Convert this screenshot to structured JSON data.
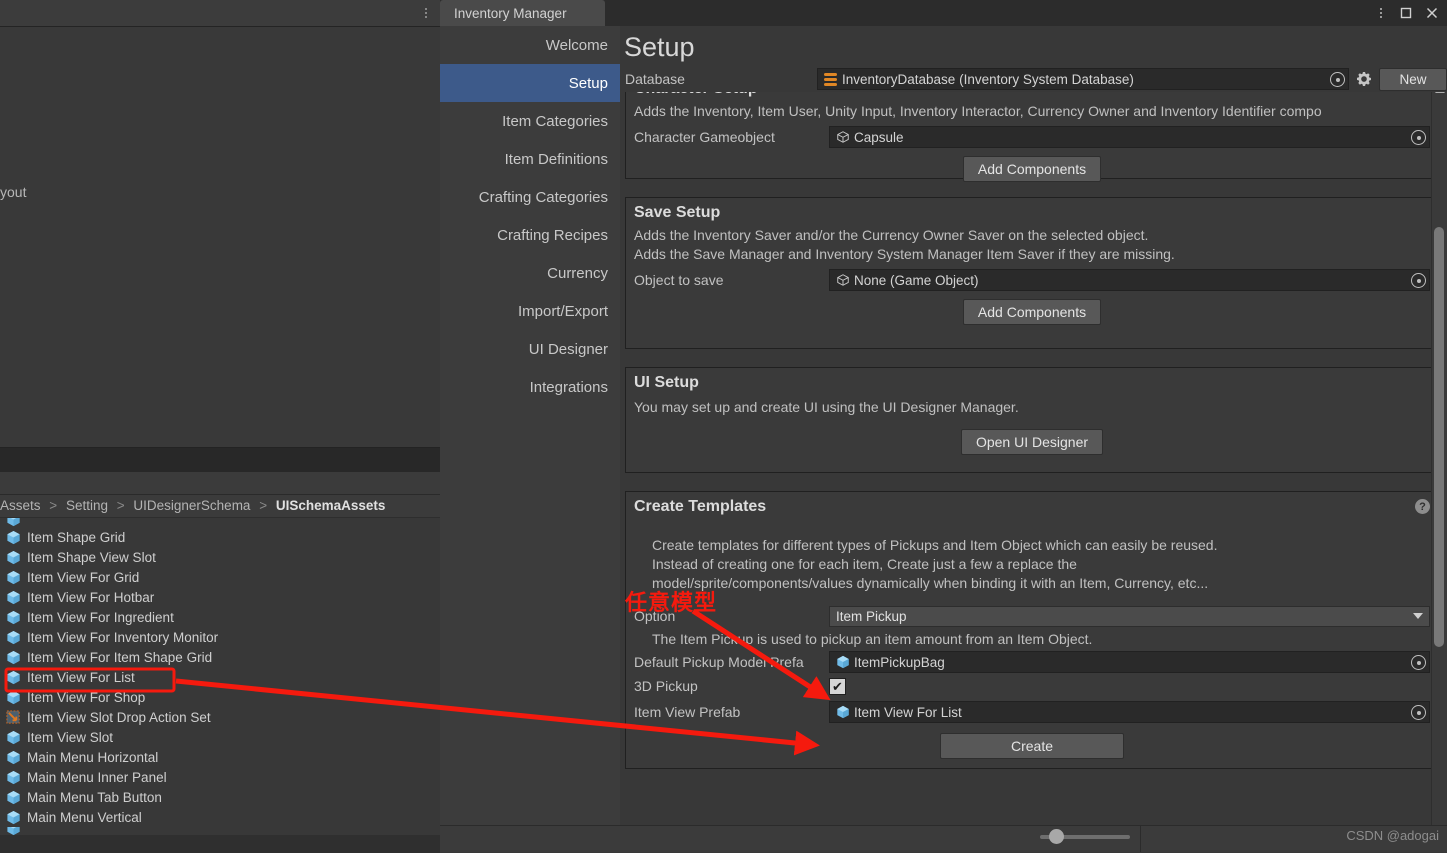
{
  "background_editor": {
    "kebab_icon": "kebab-menu-icon",
    "fragment_text": "yout"
  },
  "project_browser": {
    "breadcrumb": [
      "Assets",
      "Setting",
      "UIDesignerSchema",
      "UISchemaAssets"
    ],
    "items": [
      {
        "label": "Item Shape Grid",
        "icon": "prefab-cube-icon"
      },
      {
        "label": "Item Shape View Slot",
        "icon": "prefab-cube-icon"
      },
      {
        "label": "Item View For Grid",
        "icon": "prefab-cube-icon"
      },
      {
        "label": "Item View For Hotbar",
        "icon": "prefab-cube-icon"
      },
      {
        "label": "Item View For Ingredient",
        "icon": "prefab-cube-icon"
      },
      {
        "label": "Item View For Inventory Monitor",
        "icon": "prefab-cube-icon"
      },
      {
        "label": "Item View For Item Shape Grid",
        "icon": "prefab-cube-icon"
      },
      {
        "label": "Item View For List",
        "icon": "prefab-cube-icon",
        "highlighted": true
      },
      {
        "label": "Item View For Shop",
        "icon": "prefab-cube-icon"
      },
      {
        "label": "Item View Slot Drop Action Set",
        "icon": "action-set-icon"
      },
      {
        "label": "Item View Slot",
        "icon": "prefab-cube-icon"
      },
      {
        "label": "Main Menu Horizontal",
        "icon": "prefab-cube-icon"
      },
      {
        "label": "Main Menu Inner Panel",
        "icon": "prefab-cube-icon"
      },
      {
        "label": "Main Menu Tab Button",
        "icon": "prefab-cube-icon"
      },
      {
        "label": "Main Menu Vertical",
        "icon": "prefab-cube-icon"
      }
    ]
  },
  "inventory_manager": {
    "tab_label": "Inventory Manager",
    "window_controls": {
      "kebab": "kebab-menu-icon",
      "maximize": "maximize-icon",
      "close": "close-icon"
    },
    "nav_items": [
      {
        "label": "Welcome",
        "active": false
      },
      {
        "label": "Setup",
        "active": true
      },
      {
        "label": "Item Categories",
        "active": false
      },
      {
        "label": "Item Definitions",
        "active": false
      },
      {
        "label": "Crafting Categories",
        "active": false
      },
      {
        "label": "Crafting Recipes",
        "active": false
      },
      {
        "label": "Currency",
        "active": false
      },
      {
        "label": "Import/Export",
        "active": false
      },
      {
        "label": "UI Designer",
        "active": false
      },
      {
        "label": "Integrations",
        "active": false
      }
    ],
    "page_title": "Setup",
    "database_row": {
      "label": "Database",
      "value": "InventoryDatabase (Inventory System Database)",
      "icon": "database-icon",
      "picker_icon": "object-picker-icon",
      "gear_icon": "gear-icon",
      "new_button": "New"
    },
    "character_setup": {
      "title": "Character Setup",
      "description": "Adds the Inventory, Item User, Unity Input, Inventory Interactor, Currency Owner and Inventory Identifier compo",
      "field_label": "Character Gameobject",
      "field_value": "Capsule",
      "field_icon": "gameobject-cube-icon",
      "button": "Add Components"
    },
    "save_setup": {
      "title": "Save Setup",
      "description_line1": "Adds the Inventory Saver and/or the Currency Owner Saver on the selected object.",
      "description_line2": "Adds the Save Manager and Inventory System Manager Item Saver if they are missing.",
      "field_label": "Object to save",
      "field_value": "None (Game Object)",
      "field_icon": "gameobject-cube-icon",
      "button": "Add Components"
    },
    "ui_setup": {
      "title": "UI Setup",
      "description": "You may set up and create UI using the UI Designer Manager.",
      "button": "Open UI Designer"
    },
    "create_templates": {
      "title": "Create Templates",
      "help_badge": "?",
      "description_line1": "Create templates for different types of Pickups and Item Object which can easily be reused.",
      "description_line2": "Instead of creating one for each item, Create just a few a replace the",
      "description_line3": "model/sprite/components/values dynamically when binding it with an Item, Currency, etc...",
      "option_label": "Option",
      "option_value": "Item Pickup",
      "option_hint": "The Item Pickup is used to pickup an item amount from an Item Object.",
      "default_pickup_label": "Default Pickup Model Prefa",
      "default_pickup_value": "ItemPickupBag",
      "default_pickup_icon": "prefab-cube-icon",
      "pickup3d_label": "3D Pickup",
      "pickup3d_checked": true,
      "item_view_prefab_label": "Item View Prefab",
      "item_view_prefab_value": "Item View For List",
      "item_view_prefab_icon": "prefab-cube-icon",
      "create_button": "Create"
    },
    "scrollbar": {
      "up_arrow": "scroll-up-arrow-icon",
      "down_arrow": "scroll-down-arrow-icon"
    }
  },
  "annotations": {
    "chinese_note": "任意模型",
    "highlight_color": "#f51a0e"
  },
  "watermark": "CSDN @adogai",
  "colors": {
    "accent_selected": "#3d5a8a",
    "window_bg": "#383838",
    "panel_bg": "#3c3c3c",
    "field_bg": "#2a2a2a",
    "button_bg": "#585858",
    "annotation_red": "#f51a0e",
    "database_orange": "#e08725",
    "prefab_blue": "#7ec6f0"
  }
}
